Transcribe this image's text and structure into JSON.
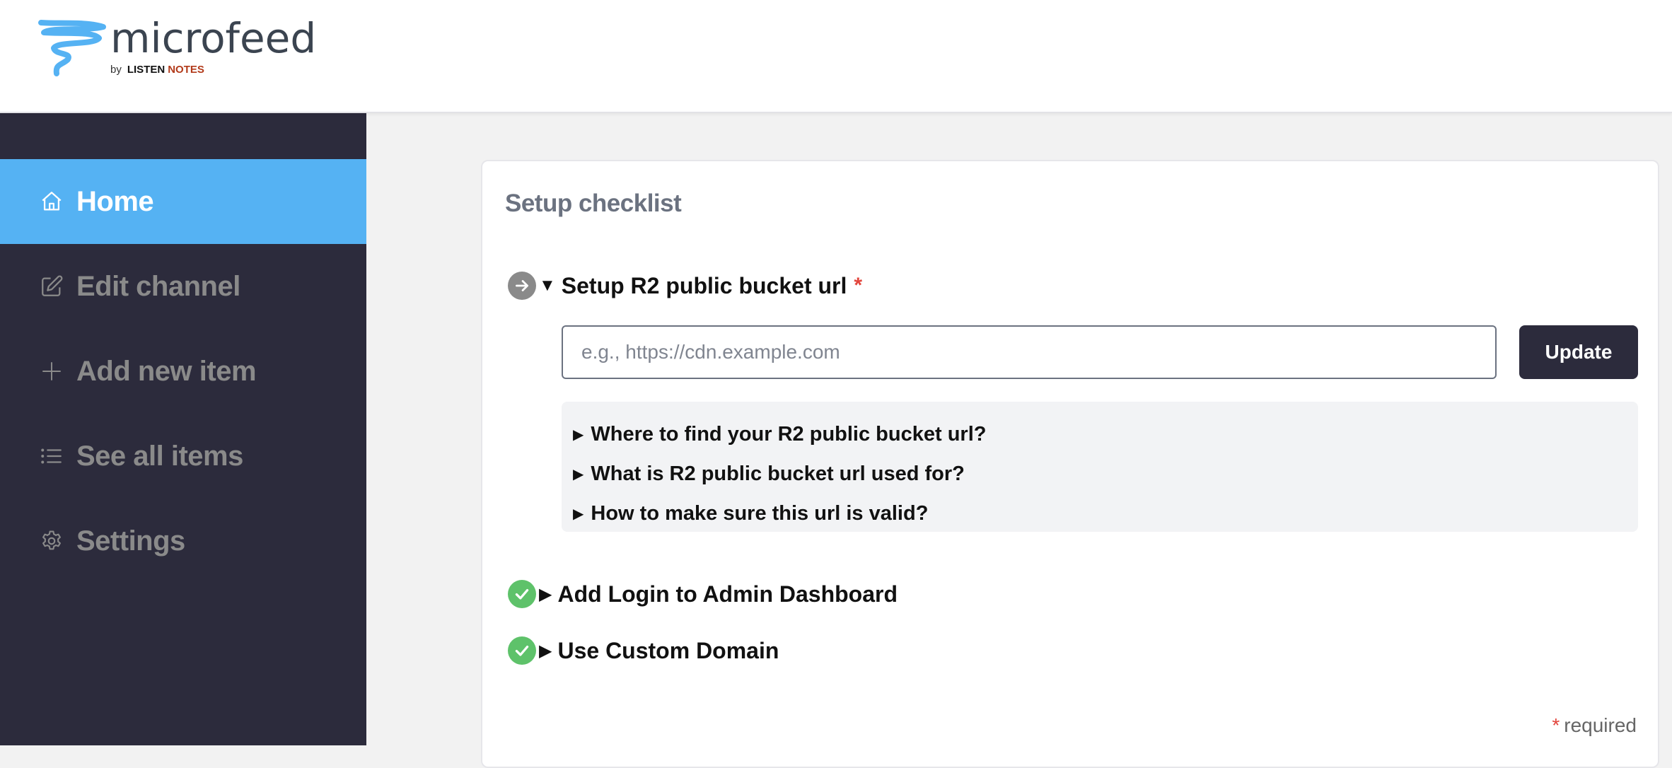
{
  "brand": {
    "name": "microfeed",
    "by": "by",
    "company_part1": "LISTEN",
    "company_part2": "NOTES",
    "accent_color": "#55b2f3",
    "company_color": "#b23a1a"
  },
  "sidebar": {
    "items": [
      {
        "label": "Home",
        "icon": "home-icon",
        "active": true
      },
      {
        "label": "Edit channel",
        "icon": "edit-icon",
        "active": false
      },
      {
        "label": "Add new item",
        "icon": "plus-icon",
        "active": false
      },
      {
        "label": "See all items",
        "icon": "list-icon",
        "active": false
      },
      {
        "label": "Settings",
        "icon": "gear-icon",
        "active": false
      }
    ]
  },
  "checklist": {
    "title": "Setup checklist",
    "steps": [
      {
        "label": "Setup R2 public bucket url",
        "required_mark": "*",
        "status": "pending",
        "expanded": true,
        "input": {
          "value": "",
          "placeholder": "e.g., https://cdn.example.com"
        },
        "button_label": "Update",
        "faqs": [
          "Where to find your R2 public bucket url?",
          "What is R2 public bucket url used for?",
          "How to make sure this url is valid?"
        ]
      },
      {
        "label": "Add Login to Admin Dashboard",
        "status": "done",
        "expanded": false
      },
      {
        "label": "Use Custom Domain",
        "status": "done",
        "expanded": false
      }
    ],
    "required_note": {
      "mark": "*",
      "text": "required"
    }
  },
  "colors": {
    "sidebar_bg": "#2c2b3c",
    "active_bg": "#55b2f3",
    "done_green": "#5ec26a",
    "pending_gray": "#8a8a8a",
    "required_red": "#e2453c"
  }
}
